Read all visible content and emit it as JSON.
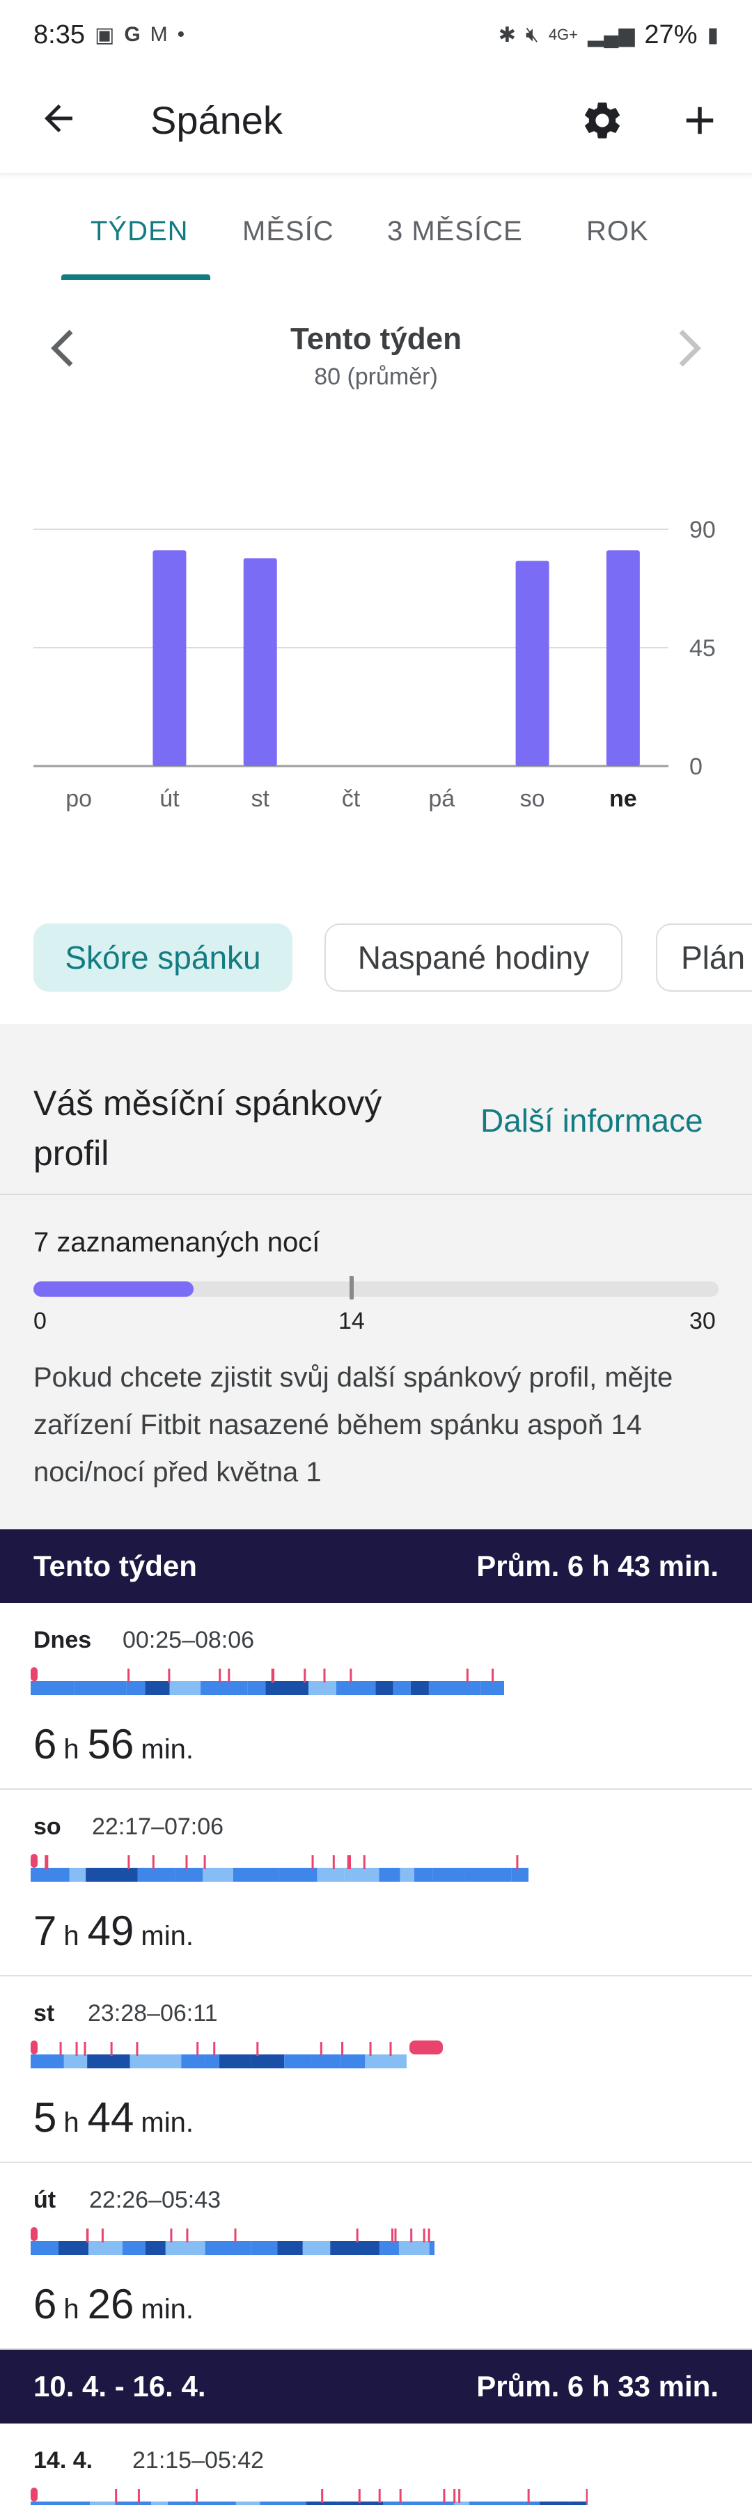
{
  "status_bar": {
    "time": "8:35",
    "battery": "27%",
    "network": "4G+"
  },
  "app_bar": {
    "title": "Spánek"
  },
  "tabs": [
    {
      "label": "TÝDEN",
      "active": true
    },
    {
      "label": "MĚSÍC",
      "active": false
    },
    {
      "label": "3 MĚSÍCE",
      "active": false
    },
    {
      "label": "ROK",
      "active": false
    }
  ],
  "week_nav": {
    "title": "Tento týden",
    "subtitle": "80 (průměr)"
  },
  "chart_data": {
    "type": "bar",
    "categories": [
      "po",
      "út",
      "st",
      "čt",
      "pá",
      "so",
      "ne"
    ],
    "values": [
      0,
      82,
      79,
      0,
      0,
      78,
      82
    ],
    "highlighted_category": "ne",
    "yticks": [
      0,
      45,
      90
    ],
    "ylim": [
      0,
      90
    ],
    "bar_color": "#7b6cf6",
    "grid": true,
    "xlabel": "",
    "ylabel": ""
  },
  "chips": [
    {
      "label": "Skóre spánku",
      "active": true
    },
    {
      "label": "Naspané hodiny",
      "active": false
    },
    {
      "label": "Plán",
      "active": false
    }
  ],
  "profile": {
    "title": "Váš měsíční spánkový profil",
    "link": "Další informace",
    "nights_label": "7 zaznamenaných nocí",
    "progress_value": 7,
    "progress_max": 30,
    "ticks": [
      "0",
      "14",
      "30"
    ],
    "description": "Pokud chcete zjistit svůj další spánkový profil, mějte zařízení Fitbit nasazené během spánku aspoň 14 noci/nocí před května 1"
  },
  "sections": [
    {
      "title": "Tento týden",
      "average": "Prům. 6 h 43 min.",
      "entries": [
        {
          "day": "Dnes",
          "time": "00:25–08:06",
          "hours": "6",
          "minutes": "56"
        },
        {
          "day": "so",
          "time": "22:17–07:06",
          "hours": "7",
          "minutes": "49"
        },
        {
          "day": "st",
          "time": "23:28–06:11",
          "hours": "5",
          "minutes": "44"
        },
        {
          "day": "út",
          "time": "22:26–05:43",
          "hours": "6",
          "minutes": "26"
        }
      ]
    },
    {
      "title": "10. 4. - 16. 4.",
      "average": "Prům. 6 h 33 min.",
      "entries": [
        {
          "day": "14. 4.",
          "time": "21:15–05:42",
          "hours": "",
          "minutes": ""
        }
      ]
    }
  ],
  "units": {
    "h": "h",
    "min": "min."
  },
  "colors": {
    "accent": "#137c82",
    "header_bg": "#1d1843",
    "deep": "#1a4fa8",
    "light": "#3f86ea",
    "rem": "#86bdf5",
    "awake": "#e8446e"
  }
}
